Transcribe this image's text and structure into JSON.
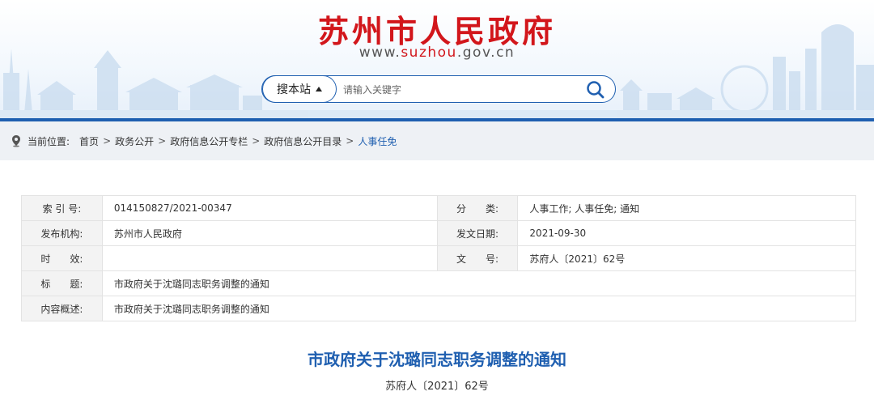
{
  "header": {
    "site_title": "苏州市人民政府",
    "url_prefix": "www.",
    "url_highlight": "suzhou",
    "url_suffix": ".gov.cn"
  },
  "search": {
    "scope_label": "搜本站",
    "placeholder": "请输入关键字",
    "button_icon": "search-icon"
  },
  "breadcrumb": {
    "prefix": "当前位置:",
    "items": [
      "首页",
      "政务公开",
      "政府信息公开专栏",
      "政府信息公开目录"
    ],
    "current": "人事任免",
    "separator": ">"
  },
  "meta": {
    "index_label": "索 引 号:",
    "index_value": "014150827/2021-00347",
    "category_label": "分　　类:",
    "category_value": "人事工作;  人事任免;  通知",
    "issuer_label": "发布机构:",
    "issuer_value": "苏州市人民政府",
    "date_label": "发文日期:",
    "date_value": "2021-09-30",
    "validity_label": "时　　效:",
    "validity_value": "",
    "docno_label": "文　　号:",
    "docno_value": "苏府人〔2021〕62号",
    "title_label": "标　　题:",
    "title_value": "市政府关于沈璐同志职务调整的通知",
    "summary_label": "内容概述:",
    "summary_value": "市政府关于沈璐同志职务调整的通知"
  },
  "document": {
    "title": "市政府关于沈璐同志职务调整的通知",
    "number": "苏府人〔2021〕62号"
  },
  "colors": {
    "brand_red": "#d2161b",
    "brand_blue": "#1f5fb0",
    "skyline": "#cfe0f1"
  }
}
